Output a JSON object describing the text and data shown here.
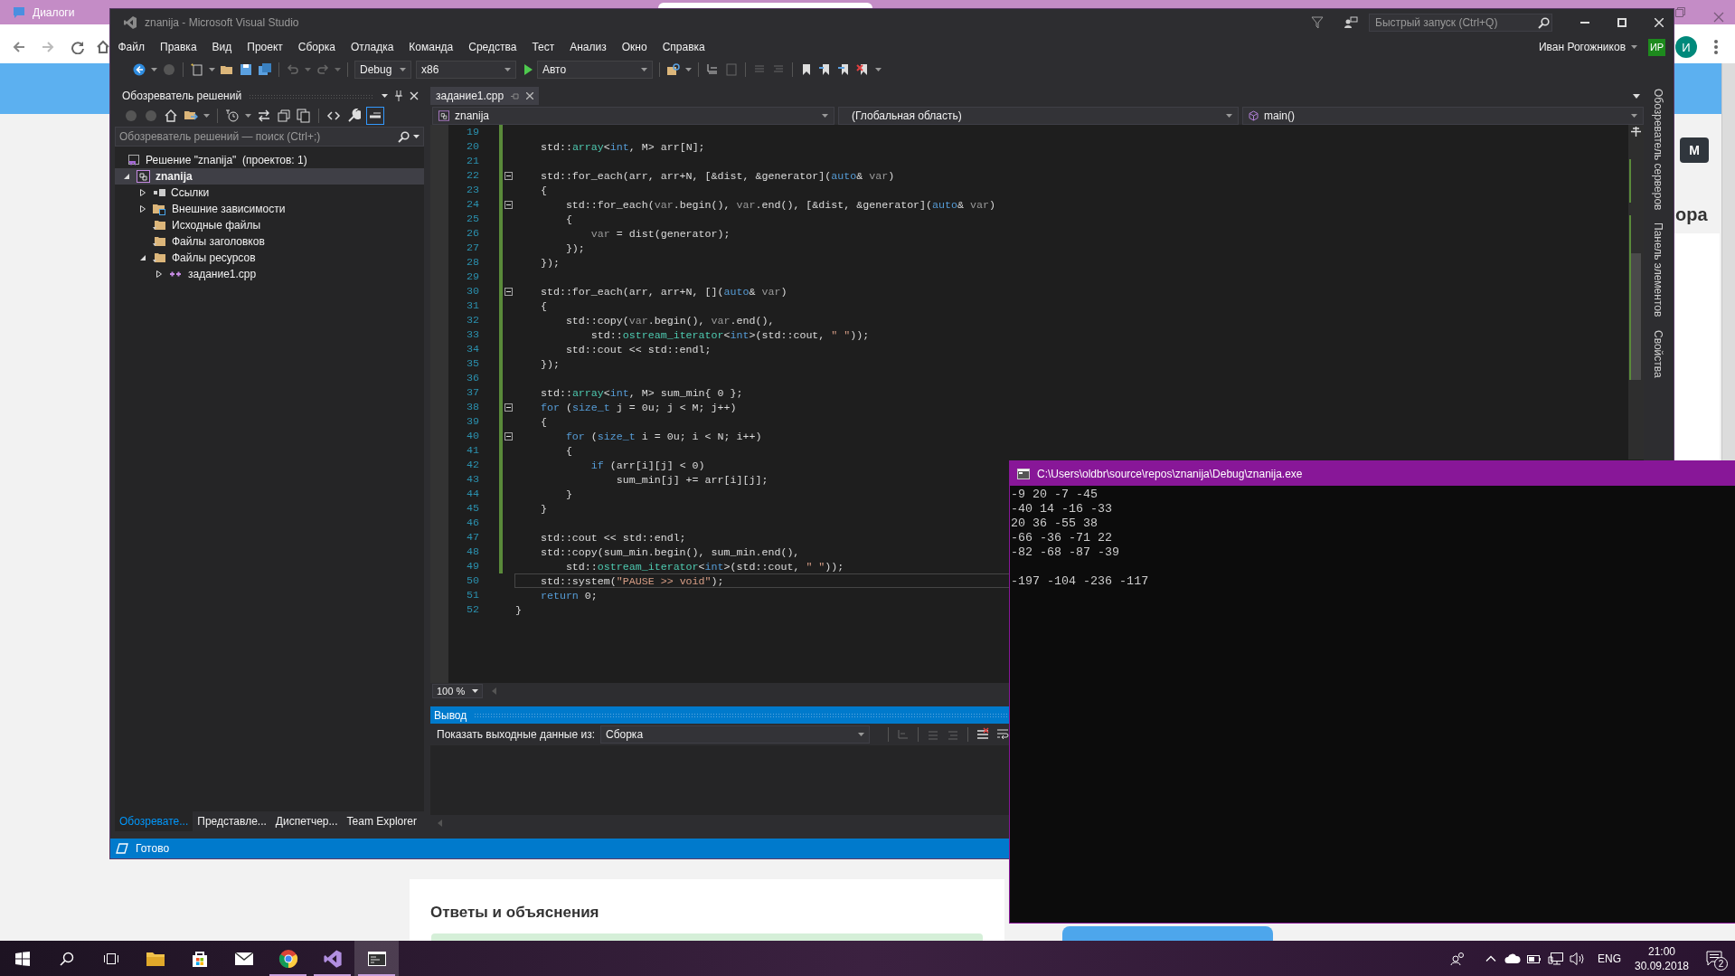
{
  "browser": {
    "tab": {
      "title": "Диалоги"
    },
    "profile": {
      "initial": "И"
    },
    "page": {
      "side_button": "M",
      "side_heading": "ора",
      "section_heading": "Ответы и объяснения"
    }
  },
  "vs_window": {
    "title": "znanija - Microsoft Visual Studio",
    "quick_launch": {
      "placeholder": "Быстрый запуск (Ctrl+Q)"
    },
    "menu": [
      "Файл",
      "Правка",
      "Вид",
      "Проект",
      "Сборка",
      "Отладка",
      "Команда",
      "Средства",
      "Тест",
      "Анализ",
      "Окно",
      "Справка"
    ],
    "user": {
      "name": "Иван Рогожников",
      "initials": "ИР"
    },
    "toolbar": {
      "configuration": "Debug",
      "platform": "x86",
      "start_target": "Авто"
    },
    "solution_explorer": {
      "title": "Обозреватель решений",
      "search": {
        "placeholder": "Обозреватель решений — поиск (Ctrl+;)"
      },
      "tree": [
        {
          "label": "Решение \"znanija\"  (проектов: 1)",
          "kind": "solution",
          "selected": false,
          "children": [
            {
              "label": "znanija",
              "kind": "project",
              "expanded": true,
              "selected": true,
              "children": [
                {
                  "label": "Ссылки",
                  "kind": "references",
                  "expanded": false,
                  "selected": false
                },
                {
                  "label": "Внешние зависимости",
                  "kind": "external",
                  "expanded": false,
                  "selected": false
                },
                {
                  "label": "Исходные файлы",
                  "kind": "filter",
                  "selected": false
                },
                {
                  "label": "Файлы заголовков",
                  "kind": "filter",
                  "selected": false
                },
                {
                  "label": "Файлы ресурсов",
                  "kind": "filter",
                  "expanded": true,
                  "selected": false,
                  "children": [
                    {
                      "label": "задание1.cpp",
                      "kind": "cpp",
                      "expanded": false,
                      "selected": false
                    }
                  ]
                }
              ]
            }
          ]
        }
      ],
      "tabs": [
        {
          "label": "Обозревате...",
          "selected": true
        },
        {
          "label": "Представле...",
          "selected": false
        },
        {
          "label": "Диспетчер...",
          "selected": false
        },
        {
          "label": "Team Explorer",
          "selected": false
        }
      ]
    },
    "editor": {
      "tabs": [
        {
          "label": "задание1.cpp",
          "selected": true
        }
      ],
      "navigation": {
        "project": "znanija",
        "scope": "(Глобальная область)",
        "member": "main()"
      },
      "zoom": "100 %",
      "lines": [
        {
          "number": "19",
          "modified": true,
          "fold": false,
          "current": false
        },
        {
          "number": "20",
          "modified": true,
          "fold": false,
          "current": false,
          "segments": [
            {
              "text": "    std::"
            },
            {
              "text": "array",
              "kind": "type"
            },
            {
              "text": "<"
            },
            {
              "text": "int",
              "kind": "keyword"
            },
            {
              "text": ", M> arr[N];"
            }
          ]
        },
        {
          "number": "21",
          "modified": true,
          "fold": false,
          "current": false
        },
        {
          "number": "22",
          "modified": true,
          "fold": true,
          "current": false,
          "segments": [
            {
              "text": "    std::for_each(arr, arr+N, [&dist, &generator]("
            },
            {
              "text": "auto",
              "kind": "keyword"
            },
            {
              "text": "& "
            },
            {
              "text": "var",
              "kind": "param"
            },
            {
              "text": ")"
            }
          ]
        },
        {
          "number": "23",
          "modified": true,
          "fold": false,
          "current": false,
          "segments": [
            {
              "text": "    {"
            }
          ]
        },
        {
          "number": "24",
          "modified": true,
          "fold": true,
          "current": false,
          "segments": [
            {
              "text": "        std::for_each("
            },
            {
              "text": "var",
              "kind": "param"
            },
            {
              "text": ".begin(), "
            },
            {
              "text": "var",
              "kind": "param"
            },
            {
              "text": ".end(), [&dist, &generator]("
            },
            {
              "text": "auto",
              "kind": "keyword"
            },
            {
              "text": "& "
            },
            {
              "text": "var",
              "kind": "param"
            },
            {
              "text": ")"
            }
          ]
        },
        {
          "number": "25",
          "modified": true,
          "fold": false,
          "current": false,
          "segments": [
            {
              "text": "        {"
            }
          ]
        },
        {
          "number": "26",
          "modified": true,
          "fold": false,
          "current": false,
          "segments": [
            {
              "text": "            var",
              "kind": "param"
            },
            {
              "text": " = dist(generator);"
            }
          ]
        },
        {
          "number": "27",
          "modified": true,
          "fold": false,
          "current": false,
          "segments": [
            {
              "text": "        });"
            }
          ]
        },
        {
          "number": "28",
          "modified": true,
          "fold": false,
          "current": false,
          "segments": [
            {
              "text": "    });"
            }
          ]
        },
        {
          "number": "29",
          "modified": true,
          "fold": false,
          "current": false
        },
        {
          "number": "30",
          "modified": true,
          "fold": true,
          "current": false,
          "segments": [
            {
              "text": "    std::for_each(arr, arr+N, []("
            },
            {
              "text": "auto",
              "kind": "keyword"
            },
            {
              "text": "& "
            },
            {
              "text": "var",
              "kind": "param"
            },
            {
              "text": ")"
            }
          ]
        },
        {
          "number": "31",
          "modified": true,
          "fold": false,
          "current": false,
          "segments": [
            {
              "text": "    {"
            }
          ]
        },
        {
          "number": "32",
          "modified": true,
          "fold": false,
          "current": false,
          "segments": [
            {
              "text": "        std::copy("
            },
            {
              "text": "var",
              "kind": "param"
            },
            {
              "text": ".begin(), "
            },
            {
              "text": "var",
              "kind": "param"
            },
            {
              "text": ".end(),"
            }
          ]
        },
        {
          "number": "33",
          "modified": true,
          "fold": false,
          "current": false,
          "segments": [
            {
              "text": "            std::"
            },
            {
              "text": "ostream_iterator",
              "kind": "type"
            },
            {
              "text": "<"
            },
            {
              "text": "int",
              "kind": "keyword"
            },
            {
              "text": ">(std::cout, "
            },
            {
              "text": "\" \"",
              "kind": "string"
            },
            {
              "text": "));"
            }
          ]
        },
        {
          "number": "34",
          "modified": true,
          "fold": false,
          "current": false,
          "segments": [
            {
              "text": "        std::cout << std::endl;"
            }
          ]
        },
        {
          "number": "35",
          "modified": true,
          "fold": false,
          "current": false,
          "segments": [
            {
              "text": "    });"
            }
          ]
        },
        {
          "number": "36",
          "modified": true,
          "fold": false,
          "current": false
        },
        {
          "number": "37",
          "modified": true,
          "fold": false,
          "current": false,
          "segments": [
            {
              "text": "    std::"
            },
            {
              "text": "array",
              "kind": "type"
            },
            {
              "text": "<"
            },
            {
              "text": "int",
              "kind": "keyword"
            },
            {
              "text": ", M> sum_min{ 0 };"
            }
          ]
        },
        {
          "number": "38",
          "modified": true,
          "fold": true,
          "current": false,
          "segments": [
            {
              "text": "    for",
              "kind": "keyword"
            },
            {
              "text": " ("
            },
            {
              "text": "size_t",
              "kind": "keyword"
            },
            {
              "text": " j = 0u; j < M; j++)"
            }
          ]
        },
        {
          "number": "39",
          "modified": true,
          "fold": false,
          "current": false,
          "segments": [
            {
              "text": "    {"
            }
          ]
        },
        {
          "number": "40",
          "modified": true,
          "fold": true,
          "current": false,
          "segments": [
            {
              "text": "        for",
              "kind": "keyword"
            },
            {
              "text": " ("
            },
            {
              "text": "size_t",
              "kind": "keyword"
            },
            {
              "text": " i = 0u; i < N; i++)"
            }
          ]
        },
        {
          "number": "41",
          "modified": true,
          "fold": false,
          "current": false,
          "segments": [
            {
              "text": "        {"
            }
          ]
        },
        {
          "number": "42",
          "modified": true,
          "fold": false,
          "current": false,
          "segments": [
            {
              "text": "            if",
              "kind": "keyword"
            },
            {
              "text": " (arr[i][j] < 0)"
            }
          ]
        },
        {
          "number": "43",
          "modified": true,
          "fold": false,
          "current": false,
          "segments": [
            {
              "text": "                sum_min[j] += arr[i][j];"
            }
          ]
        },
        {
          "number": "44",
          "modified": true,
          "fold": false,
          "current": false,
          "segments": [
            {
              "text": "        }"
            }
          ]
        },
        {
          "number": "45",
          "modified": true,
          "fold": false,
          "current": false,
          "segments": [
            {
              "text": "    }"
            }
          ]
        },
        {
          "number": "46",
          "modified": true,
          "fold": false,
          "current": false
        },
        {
          "number": "47",
          "modified": true,
          "fold": false,
          "current": false,
          "segments": [
            {
              "text": "    std::cout << std::endl;"
            }
          ]
        },
        {
          "number": "48",
          "modified": true,
          "fold": false,
          "current": false,
          "segments": [
            {
              "text": "    std::copy(sum_min.begin(), sum_min.end(),"
            }
          ]
        },
        {
          "number": "49",
          "modified": true,
          "fold": false,
          "current": false,
          "segments": [
            {
              "text": "        std::"
            },
            {
              "text": "ostream_iterator",
              "kind": "type"
            },
            {
              "text": "<"
            },
            {
              "text": "int",
              "kind": "keyword"
            },
            {
              "text": ">(std::cout, "
            },
            {
              "text": "\" \"",
              "kind": "string"
            },
            {
              "text": "));"
            }
          ]
        },
        {
          "number": "50",
          "modified": false,
          "fold": false,
          "current": true,
          "segments": [
            {
              "text": "    std::system("
            },
            {
              "text": "\"PAUSE >> void\"",
              "kind": "string"
            },
            {
              "text": ");"
            }
          ]
        },
        {
          "number": "51",
          "modified": false,
          "fold": false,
          "current": false,
          "segments": [
            {
              "text": "    return",
              "kind": "keyword"
            },
            {
              "text": " 0;"
            }
          ]
        },
        {
          "number": "52",
          "modified": false,
          "fold": false,
          "current": false,
          "segments": [
            {
              "text": "}"
            }
          ]
        }
      ]
    },
    "output": {
      "title": "Вывод",
      "source_label": "Показать выходные данные из:",
      "source": "Сборка"
    },
    "side_tabs": [
      "Обозреватель серверов",
      "Панель элементов",
      "Свойства"
    ],
    "status": "Готово"
  },
  "console": {
    "title": "C:\\Users\\oldbr\\source\\repos\\znanija\\Debug\\znanija.exe",
    "rows": [
      "-9 20 -7 -45",
      "-40 14 -16 -33",
      "20 36 -55 38",
      "-66 -36 -71 22",
      "-82 -68 -87 -39"
    ],
    "result": "-197 -104 -236 -117"
  },
  "taskbar": {
    "apps": [
      {
        "kind": "explorer",
        "running": false,
        "focused": false
      },
      {
        "kind": "store",
        "running": false,
        "focused": false
      },
      {
        "kind": "mail",
        "running": false,
        "focused": false
      },
      {
        "kind": "chrome",
        "running": true,
        "focused": false
      },
      {
        "kind": "visual-studio",
        "running": true,
        "focused": false
      },
      {
        "kind": "console",
        "running": true,
        "focused": true
      }
    ],
    "language": "ENG",
    "time": "21:00",
    "date": "30.09.2018",
    "notifications": "2"
  }
}
